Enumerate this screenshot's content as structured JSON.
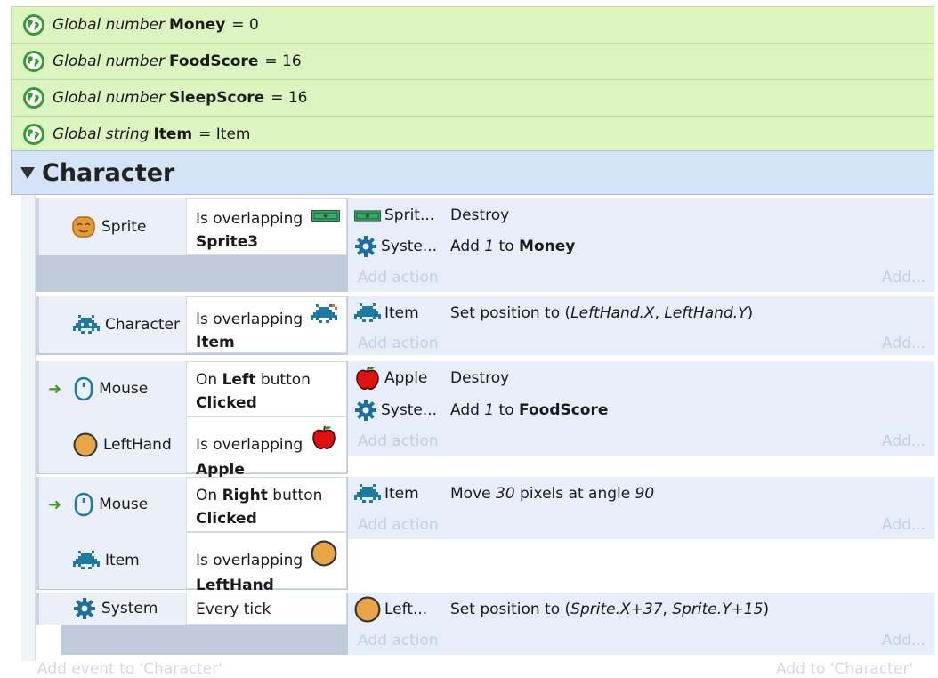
{
  "globals": [
    {
      "kind": "Global number",
      "name": "Money",
      "value": "= 0"
    },
    {
      "kind": "Global number",
      "name": "FoodScore",
      "value": "= 16"
    },
    {
      "kind": "Global number",
      "name": "SleepScore",
      "value": "= 16"
    },
    {
      "kind": "Global string",
      "name": "Item",
      "value": "= Item"
    }
  ],
  "group": {
    "title": "Character"
  },
  "events": [
    {
      "obj": "Sprite",
      "cond_prefix": "Is overlapping",
      "cond_obj": "Sprite3",
      "actions": [
        {
          "obj": "Sprit...",
          "text": "Destroy"
        },
        {
          "obj": "Syste...",
          "pre": "Add ",
          "em": "1",
          "mid": " to ",
          "strong": "Money"
        }
      ]
    },
    {
      "obj": "Character",
      "cond_prefix": "Is overlapping",
      "cond_obj": "Item",
      "actions": [
        {
          "obj": "Item",
          "pre": "Set position to (",
          "em1": "LeftHand.X",
          "sep": ", ",
          "em2": "LeftHand.Y",
          "post": ")"
        }
      ]
    },
    {
      "trigger_obj": "Mouse",
      "trigger_pre": "On ",
      "trigger_bold": "Left",
      "trigger_post": " button",
      "trigger_bold2": "Clicked",
      "obj2": "LeftHand",
      "cond_prefix": "Is overlapping",
      "cond_obj": "Apple",
      "actions": [
        {
          "obj": "Apple",
          "text": "Destroy"
        },
        {
          "obj": "Syste...",
          "pre": "Add ",
          "em": "1",
          "mid": " to ",
          "strong": "FoodScore"
        }
      ]
    },
    {
      "trigger_obj": "Mouse",
      "trigger_pre": "On ",
      "trigger_bold": "Right",
      "trigger_post": " button",
      "trigger_bold2": "Clicked",
      "obj2": "Item",
      "cond_prefix": "Is overlapping",
      "cond_obj": "LeftHand",
      "actions": [
        {
          "obj": "Item",
          "pre": "Move ",
          "em": "30",
          "mid": " pixels at angle ",
          "em2": "90"
        }
      ]
    },
    {
      "obj": "System",
      "cond_text": "Every tick",
      "actions": [
        {
          "obj": "Left...",
          "pre": "Set position to (",
          "em1": "Sprite.X+37",
          "sep": ", ",
          "em2": "Sprite.Y+15",
          "post": ")"
        }
      ]
    }
  ],
  "labels": {
    "add_action": "Add action",
    "add_more": "Add...",
    "arrow": "➜",
    "add_event": "Add event to 'Character'",
    "add_to": "Add to 'Character'"
  },
  "colors": {
    "global_bg": "#dcf4c0",
    "group_bg": "#d4e3f5",
    "action_bg": "#e7eef9",
    "trigger_arrow": "#3a9a2a"
  },
  "icons": {
    "global": "globe-icon",
    "sprite": "sprite-face-icon",
    "character": "space-invader-icon",
    "system": "gear-icon",
    "mouse": "mouse-icon",
    "lefthand": "orange-circle-icon",
    "apple": "apple-icon",
    "sprite3": "green-banknote-icon"
  }
}
